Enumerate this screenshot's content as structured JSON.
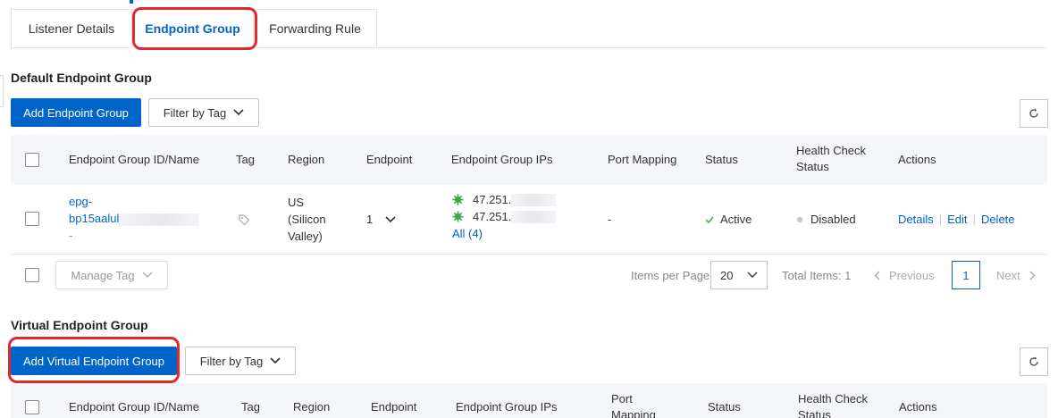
{
  "tabs": [
    {
      "label": "Listener Details"
    },
    {
      "label": "Endpoint Group"
    },
    {
      "label": "Forwarding Rule"
    }
  ],
  "default_group": {
    "title": "Default Endpoint Group",
    "add_button": "Add Endpoint Group",
    "filter_button": "Filter by Tag",
    "columns": [
      "Endpoint Group ID/Name",
      "Tag",
      "Region",
      "Endpoint",
      "Endpoint Group IPs",
      "Port Mapping",
      "Status",
      "Health Check Status",
      "Actions"
    ],
    "row": {
      "id_line1": "epg-",
      "id_line2": "bp15aalul",
      "id_line3": "-",
      "region_line1": "US",
      "region_line2": "(Silicon",
      "region_line3": "Valley)",
      "endpoint_count": "1",
      "ip1": "47.251.",
      "ip2": "47.251.",
      "ip_all": "All (4)",
      "port_mapping": "-",
      "status": "Active",
      "health": "Disabled",
      "action_details": "Details",
      "action_edit": "Edit",
      "action_delete": "Delete"
    },
    "footer": {
      "manage_tag": "Manage Tag",
      "items_per_page_label": "Items per Page",
      "items_per_page_value": "20",
      "total_items": "Total Items: 1",
      "previous": "Previous",
      "page": "1",
      "next": "Next"
    }
  },
  "virtual_group": {
    "title": "Virtual Endpoint Group",
    "add_button": "Add Virtual Endpoint Group",
    "filter_button": "Filter by Tag",
    "col_id": "Endpoint Group ID/Name",
    "col_tag": "Tag",
    "col_region": "Region",
    "col_endpoint": "Endpoint",
    "col_ips": "Endpoint Group IPs",
    "col_port_1": "Port",
    "col_port_2": "Mapping",
    "col_status": "Status",
    "col_health_1": "Health Check",
    "col_health_2": "Status",
    "col_actions": "Actions"
  },
  "colors": {
    "primary": "#0064c8",
    "highlight": "#e0282e",
    "success": "#3aa845",
    "header_bg": "#f5f6fa"
  }
}
